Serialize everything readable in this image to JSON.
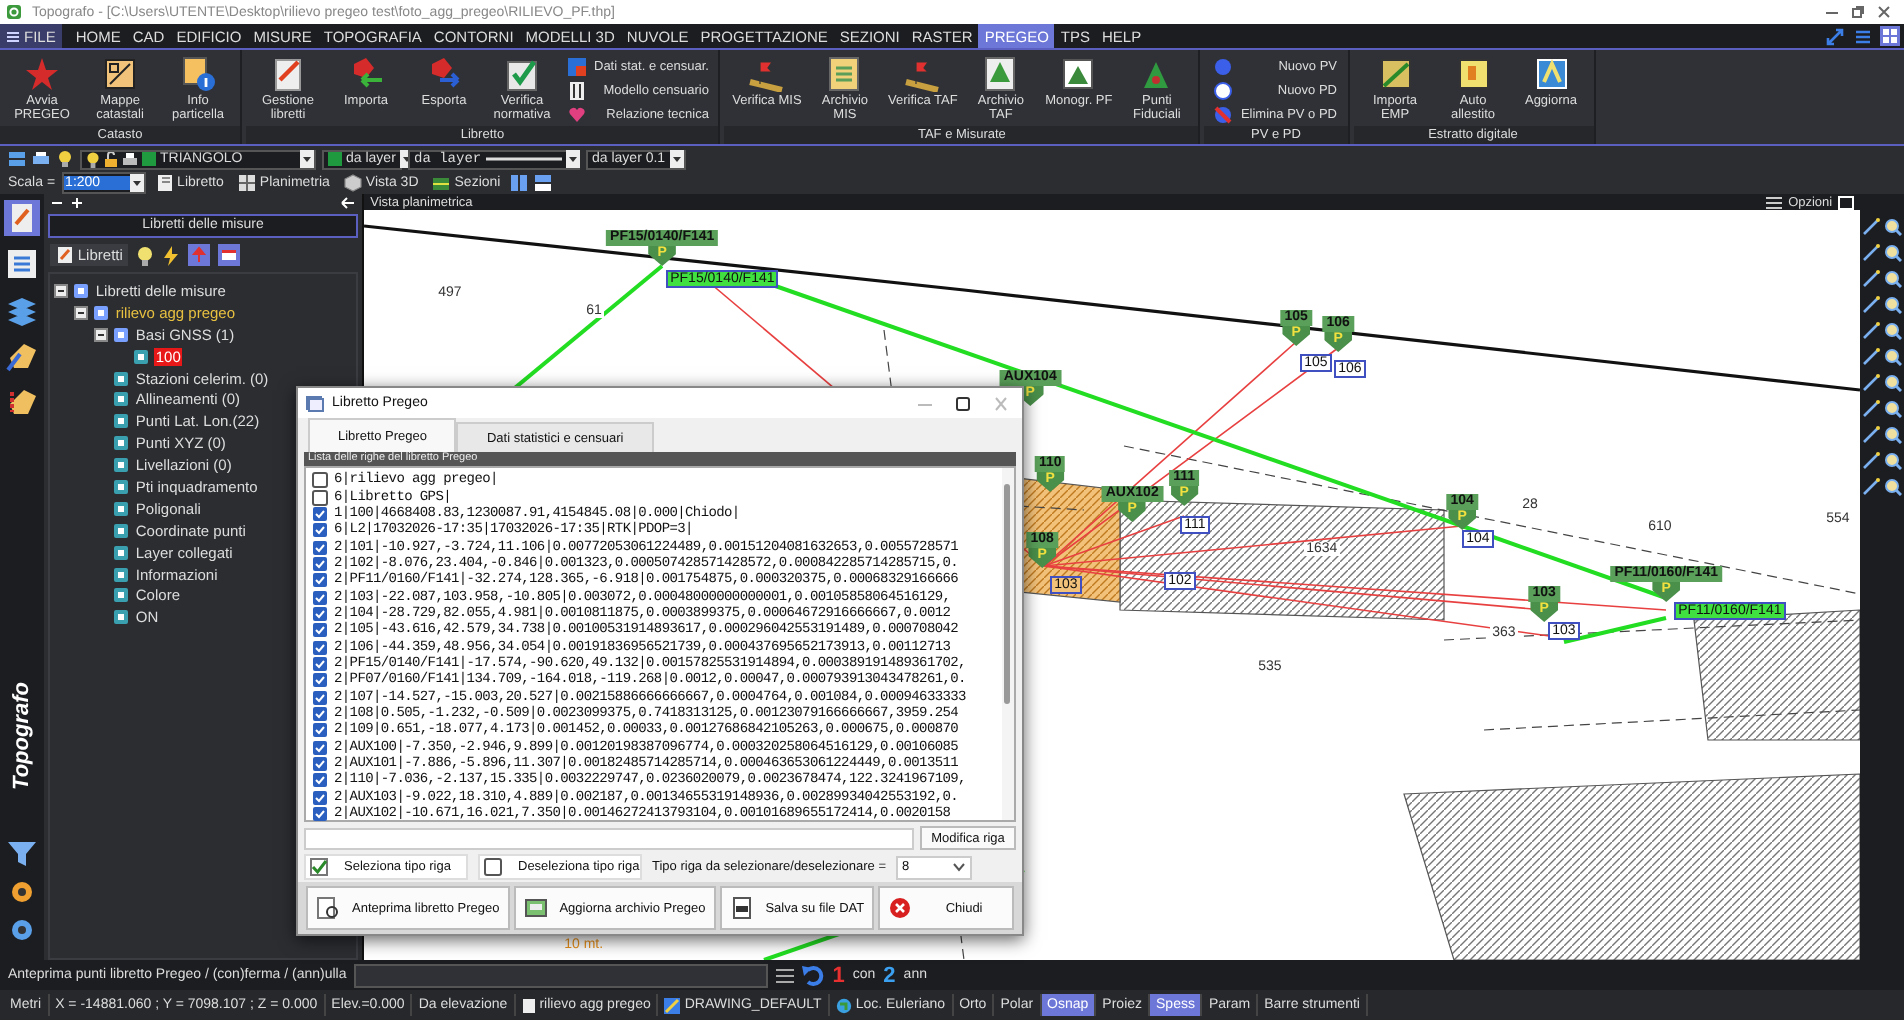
{
  "window": {
    "title": "Topografo - [C:\\Users\\UTENTE\\Desktop\\rilievo pregeo test\\foto_agg_pregeo\\RILIEVO_PF.thp]"
  },
  "menu": [
    {
      "label": "FILE",
      "kind": "app",
      "selected": false
    },
    {
      "label": "HOME",
      "kind": "tab",
      "selected": false
    },
    {
      "label": "CAD",
      "kind": "tab",
      "selected": false
    },
    {
      "label": "EDIFICIO",
      "kind": "tab",
      "selected": false
    },
    {
      "label": "MISURE",
      "kind": "tab",
      "selected": false
    },
    {
      "label": "TOPOGRAFIA",
      "kind": "tab",
      "selected": false
    },
    {
      "label": "CONTORNI",
      "kind": "tab",
      "selected": false
    },
    {
      "label": "MODELLI 3D",
      "kind": "tab",
      "selected": false
    },
    {
      "label": "NUVOLE",
      "kind": "tab",
      "selected": false
    },
    {
      "label": "PROGETTAZIONE",
      "kind": "tab",
      "selected": false
    },
    {
      "label": "SEZIONI",
      "kind": "tab",
      "selected": false
    },
    {
      "label": "RASTER",
      "kind": "tab",
      "selected": false
    },
    {
      "label": "PREGEO",
      "kind": "tab",
      "selected": true
    },
    {
      "label": "TPS",
      "kind": "tab",
      "selected": false
    },
    {
      "label": "HELP",
      "kind": "tab",
      "selected": false
    }
  ],
  "ribbon": {
    "groups": [
      {
        "title": "Catasto",
        "items": [
          {
            "kind": "large",
            "label": "Avvia PREGEO"
          },
          {
            "kind": "large",
            "label": "Mappe catastali"
          },
          {
            "kind": "large",
            "label": "Info particella"
          }
        ]
      },
      {
        "title": "Libretto",
        "items": [
          {
            "kind": "large",
            "label": "Gestione libretti"
          },
          {
            "kind": "large",
            "label": "Importa"
          },
          {
            "kind": "large",
            "label": "Esporta"
          },
          {
            "kind": "large",
            "label": "Verifica normativa"
          },
          {
            "kind": "small",
            "label": "Dati stat. e censuar."
          },
          {
            "kind": "small",
            "label": "Modello censuario"
          },
          {
            "kind": "small",
            "label": "Relazione tecnica"
          }
        ]
      },
      {
        "title": "TAF e Misurate",
        "items": [
          {
            "kind": "large",
            "label": "Verifica MIS"
          },
          {
            "kind": "large",
            "label": "Archivio MIS"
          },
          {
            "kind": "large",
            "label": "Verifica TAF"
          },
          {
            "kind": "large",
            "label": "Archivio TAF"
          },
          {
            "kind": "large",
            "label": "Monogr. PF"
          },
          {
            "kind": "large",
            "label": "Punti Fiduciali"
          }
        ]
      },
      {
        "title": "PV e PD",
        "items": [
          {
            "kind": "small",
            "label": "Nuovo PV"
          },
          {
            "kind": "small",
            "label": "Nuovo PD"
          },
          {
            "kind": "small",
            "label": "Elimina PV o PD"
          }
        ]
      },
      {
        "title": "Estratto digitale",
        "items": [
          {
            "kind": "large",
            "label": "Importa EMP"
          },
          {
            "kind": "large",
            "label": "Auto allestito"
          },
          {
            "kind": "large",
            "label": "Aggiorna"
          }
        ]
      }
    ]
  },
  "toolbar": {
    "layer": "TRIANGOLO",
    "color_setting": "da layer",
    "linetype": "da layer",
    "lineweight": "da layer 0.1",
    "scale_label": "Scala =",
    "scale": "1:200",
    "views": [
      "Libretto",
      "Planimetria",
      "Vista 3D",
      "Sezioni"
    ]
  },
  "side_label": "Topografo",
  "left_panel": {
    "title": "Libretti delle misure",
    "toolbar_label": "Libretti",
    "tree": [
      {
        "label": "Libretti delle misure",
        "selected": false,
        "current": false,
        "expanded": true,
        "children": [
          {
            "label": "rilievo agg pregeo",
            "selected": false,
            "current": true,
            "expanded": true,
            "children": [
              {
                "label": "Basi GNSS (1)",
                "selected": false,
                "current": false,
                "expanded": true,
                "children": [
                  {
                    "label": "100",
                    "selected": true,
                    "current": false
                  }
                ]
              },
              {
                "label": "Stazioni celerim. (0)",
                "selected": false,
                "current": false
              },
              {
                "label": "Allineamenti (0)",
                "selected": false,
                "current": false
              },
              {
                "label": "Punti Lat. Lon.(22)",
                "selected": false,
                "current": false
              },
              {
                "label": "Punti XYZ (0)",
                "selected": false,
                "current": false
              },
              {
                "label": "Livellazioni (0)",
                "selected": false,
                "current": false
              },
              {
                "label": "Pti inquadramento",
                "selected": false,
                "current": false
              },
              {
                "label": "Poligonali",
                "selected": false,
                "current": false
              },
              {
                "label": "Coordinate punti",
                "selected": false,
                "current": false
              },
              {
                "label": "Layer collegati",
                "selected": false,
                "current": false
              },
              {
                "label": "Informazioni",
                "selected": false,
                "current": false
              },
              {
                "label": "Colore",
                "selected": false,
                "current": false
              },
              {
                "label": "ON",
                "selected": false,
                "current": false
              }
            ]
          }
        ]
      }
    ]
  },
  "map": {
    "title": "Vista planimetrica",
    "options": "Opzioni",
    "markers": [
      {
        "label": "PF15/0140/F141",
        "symbol": "P"
      },
      {
        "label": "105",
        "symbol": "P"
      },
      {
        "label": "106",
        "symbol": "P"
      },
      {
        "label": "AUX104",
        "symbol": "P"
      },
      {
        "label": "110",
        "symbol": "P"
      },
      {
        "label": "111",
        "symbol": "P"
      },
      {
        "label": "AUX102",
        "symbol": "P"
      },
      {
        "label": "108",
        "symbol": "P"
      },
      {
        "label": "104",
        "symbol": "P"
      },
      {
        "label": "103",
        "symbol": "P"
      },
      {
        "label": "PF11/0160/F141",
        "symbol": "P"
      }
    ],
    "point_labels": [
      {
        "text": "PF15/0140/F141",
        "kind": "fiducial"
      },
      {
        "text": "105",
        "kind": "point"
      },
      {
        "text": "106",
        "kind": "point"
      },
      {
        "text": "111",
        "kind": "point"
      },
      {
        "text": "102",
        "kind": "point"
      },
      {
        "text": "103",
        "kind": "highlighted"
      },
      {
        "text": "104",
        "kind": "point"
      },
      {
        "text": "103",
        "kind": "point"
      },
      {
        "text": "PF11/0160/F141",
        "kind": "fiducial"
      }
    ],
    "parcel_numbers": [
      "497",
      "61",
      "28",
      "610",
      "554",
      "1634",
      "535",
      "363"
    ],
    "scale_label": "10 mt."
  },
  "dialog": {
    "title": "Libretto Pregeo",
    "tabs": [
      {
        "label": "Libretto Pregeo",
        "selected": true
      },
      {
        "label": "Dati statistici e censuari",
        "selected": false
      }
    ],
    "list_title": "Lista delle righe del libretto Pregeo",
    "rows": [
      {
        "text": "6|rilievo agg pregeo|",
        "checked": false
      },
      {
        "text": "6|Libretto GPS|",
        "checked": false
      },
      {
        "text": "1|100|4668408.83,1230087.91,4154845.08|0.000|Chiodo|",
        "checked": true
      },
      {
        "text": "6|L2|17032026-17:35|17032026-17:35|RTK|PDOP=3|",
        "checked": true
      },
      {
        "text": "2|101|-10.927,-3.724,11.106|0.00772053061224489,0.00151204081632653,0.0055728571",
        "checked": true
      },
      {
        "text": "2|102|-8.076,23.404,-0.846|0.001323,0.000507428571428572,0.000842285714285715,0.",
        "checked": true
      },
      {
        "text": "2|PF11/0160/F141|-32.274,128.365,-6.918|0.001754875,0.000320375,0.00068329166666",
        "checked": true
      },
      {
        "text": "2|103|-22.087,103.958,-10.805|0.003072,0.00048000000000001,0.00105858064516129,",
        "checked": true
      },
      {
        "text": "2|104|-28.729,82.055,4.981|0.0010811875,0.0003899375,0.00064672916666667,0.0012",
        "checked": true
      },
      {
        "text": "2|105|-43.616,42.579,34.738|0.00100531914893617,0.000296042553191489,0.000708042",
        "checked": true
      },
      {
        "text": "2|106|-44.359,48.956,34.054|0.00191836956521739,0.000437695652173913,0.00112713",
        "checked": true
      },
      {
        "text": "2|PF15/0140/F141|-17.574,-90.620,49.132|0.00157825531914894,0.000389191489361702,",
        "checked": true
      },
      {
        "text": "2|PF07/0160/F141|134.709,-164.018,-119.268|0.0012,0.00047,0.000793913043478261,0.",
        "checked": true
      },
      {
        "text": "2|107|-14.527,-15.003,20.527|0.00215886666666667,0.0004764,0.001084,0.00094633333",
        "checked": true
      },
      {
        "text": "2|108|0.505,-1.232,-0.509|0.0023099375,0.7418313125,0.00123079166666667,3959.254",
        "checked": true
      },
      {
        "text": "2|109|0.651,-18.077,4.173|0.001452,0.00033,0.00127686842105263,0.000675,0.000870",
        "checked": true
      },
      {
        "text": "2|AUX100|-7.350,-2.946,9.899|0.00120198387096774,0.000320258064516129,0.00106085",
        "checked": true
      },
      {
        "text": "2|AUX101|-7.886,-5.896,11.307|0.00182485714285714,0.000463653061224449,0.0013511",
        "checked": true
      },
      {
        "text": "2|110|-7.036,-2.137,15.335|0.0032229747,0.0236020079,0.0023678474,122.3241967109,",
        "checked": true
      },
      {
        "text": "2|AUX103|-9.022,18.310,4.889|0.002187,0.00134655319148936,0.00289934042553192,0.",
        "checked": true
      },
      {
        "text": "2|AUX102|-10.671,16.021,7.350|0.00146272413793104,0.00101689655172414,0.0020158",
        "checked": true
      }
    ],
    "edit_button": "Modifica riga",
    "select_type": {
      "label": "Seleziona tipo riga",
      "checked": true
    },
    "deselect_type": {
      "label": "Deseleziona tipo riga",
      "checked": false
    },
    "type_label": "Tipo riga da selezionare/deselezionare =",
    "type_value": "8",
    "buttons": [
      "Anteprima libretto Pregeo",
      "Aggiorna archivio Pregeo",
      "Salva su file DAT",
      "Chiudi"
    ]
  },
  "command_line": {
    "prompt": "Anteprima punti libretto Pregeo / (con)ferma / (ann)ulla",
    "confirm_key": "1",
    "confirm": "con",
    "cancel_key": "2",
    "cancel": "ann"
  },
  "status_bar": [
    {
      "kind": "text",
      "label": "Metri"
    },
    {
      "kind": "text",
      "label": "X = -14881.060 ; Y = 7098.107 ; Z = 0.000"
    },
    {
      "kind": "text",
      "label": "Elev.=0.000"
    },
    {
      "kind": "text",
      "label": "Da elevazione"
    },
    {
      "kind": "layer",
      "label": "rilievo agg pregeo"
    },
    {
      "kind": "drawing",
      "label": "DRAWING_DEFAULT"
    },
    {
      "kind": "locale",
      "label": "Loc. Euleriano"
    },
    {
      "kind": "toggle",
      "label": "Orto",
      "on": false
    },
    {
      "kind": "toggle",
      "label": "Polar",
      "on": false
    },
    {
      "kind": "toggle",
      "label": "Osnap",
      "on": true
    },
    {
      "kind": "toggle",
      "label": "Proiez",
      "on": false
    },
    {
      "kind": "toggle",
      "label": "Spess",
      "on": true
    },
    {
      "kind": "toggle",
      "label": "Param",
      "on": false
    },
    {
      "kind": "menu",
      "label": "Barre strumenti"
    }
  ]
}
